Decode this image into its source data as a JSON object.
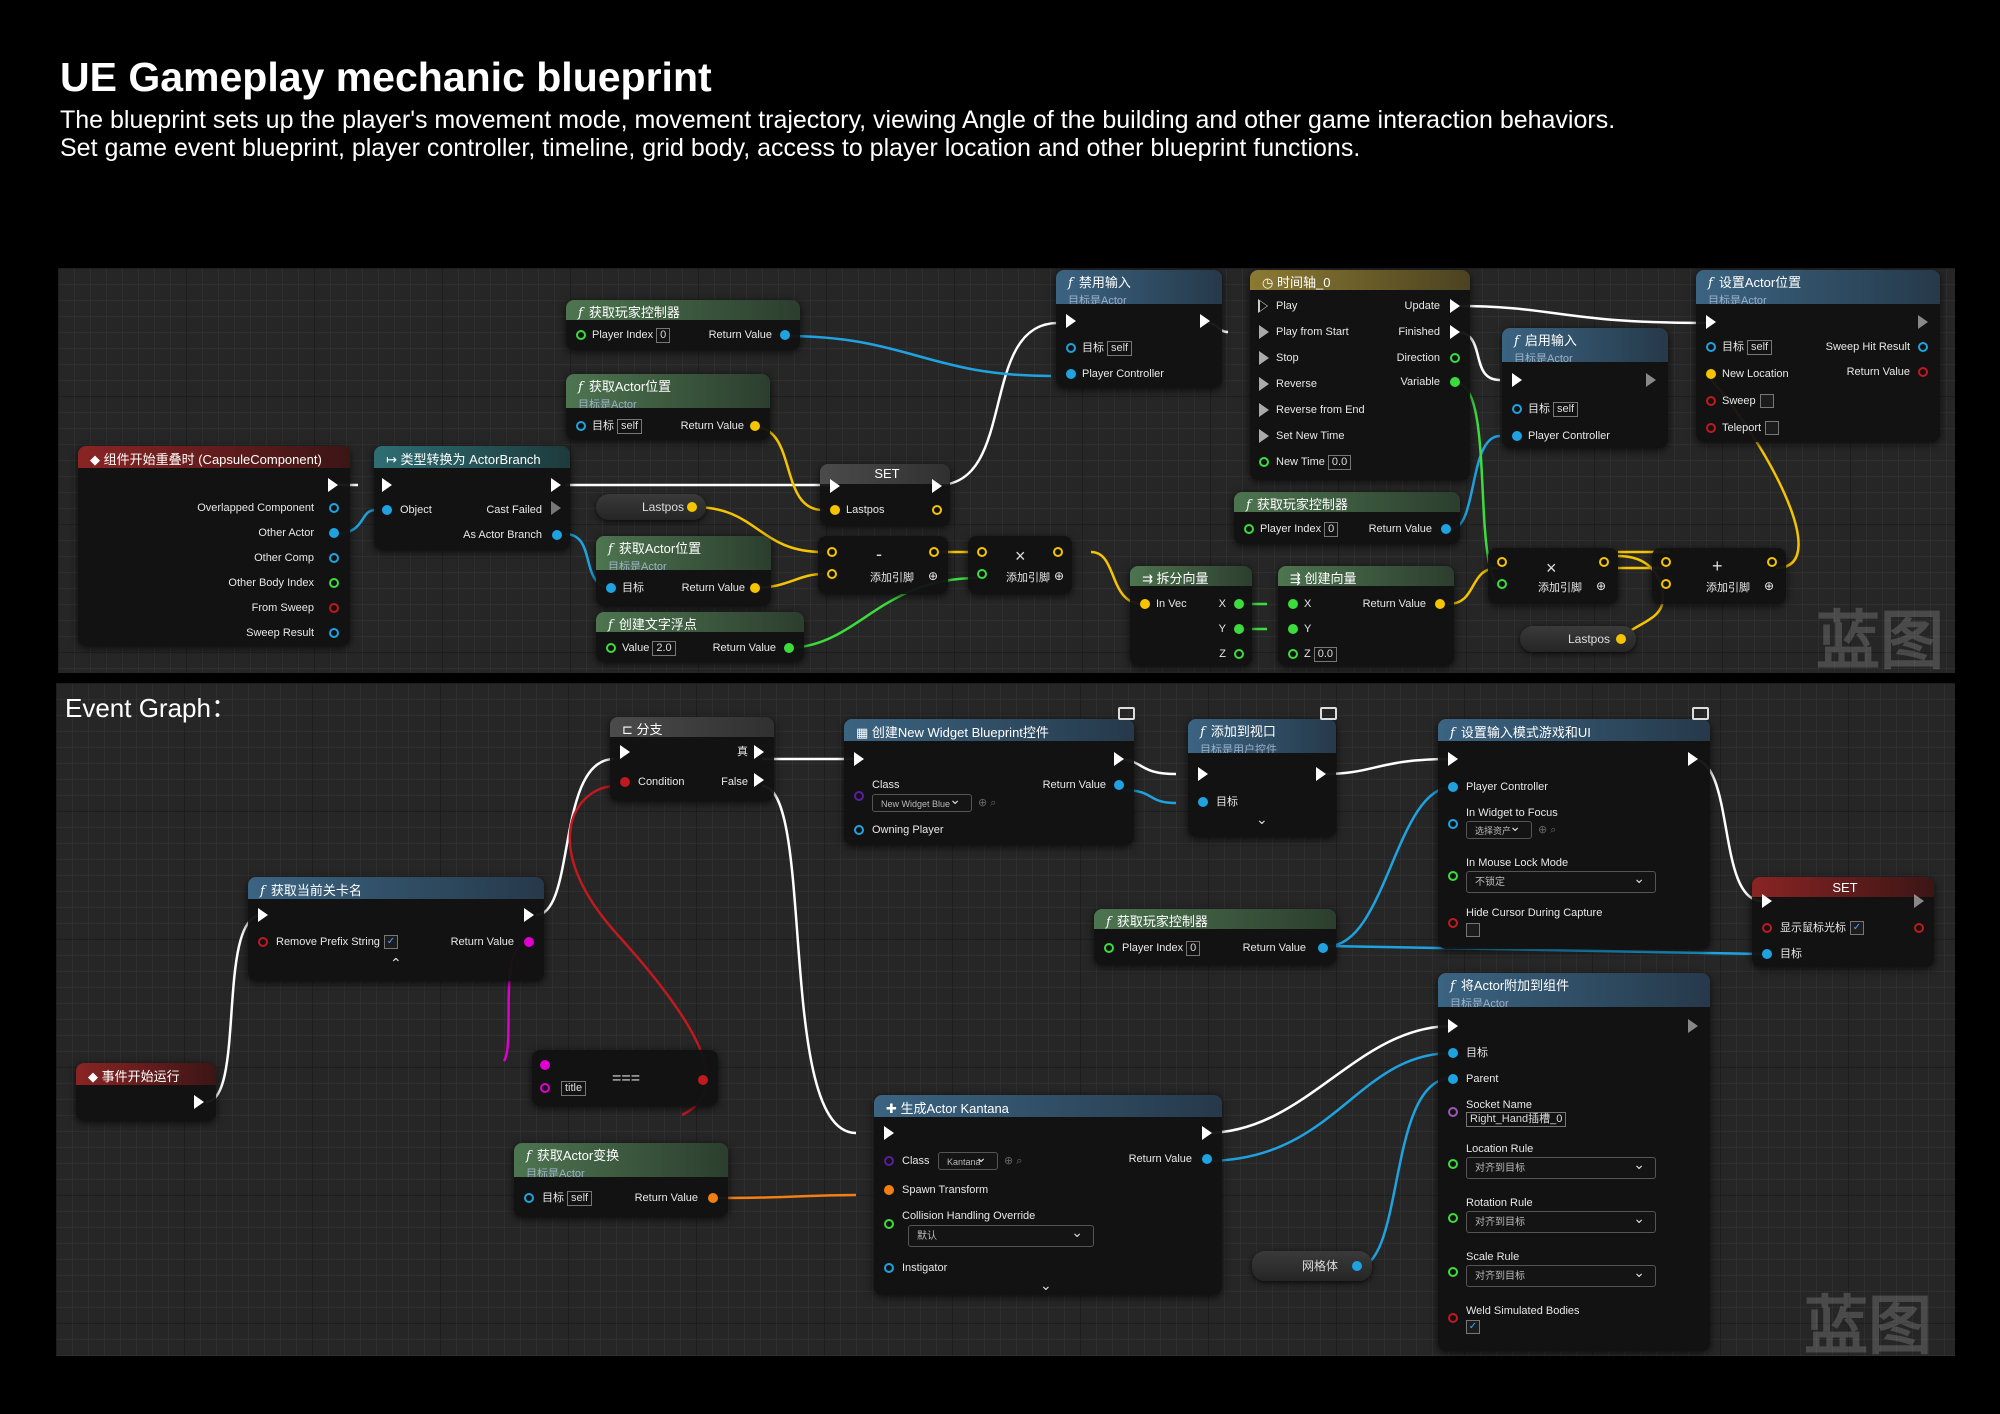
{
  "page": {
    "title": "UE Gameplay mechanic blueprint",
    "description": "The blueprint sets up the player's movement mode, movement trajectory, viewing Angle of the building and other game interaction behaviors. Set game event blueprint, player controller, timeline, grid body, access to player location and other blueprint functions."
  },
  "colors": {
    "exec": "#ffffff",
    "object": "#1fa3e0",
    "vector": "#f5c400",
    "float": "#3ddc3d",
    "bool": "#c0191f",
    "string": "#e000d0",
    "transform": "#f07f14",
    "class": "#5a1ea0"
  },
  "graph_top": {
    "watermark": "蓝图",
    "overlap_event": {
      "title": "组件开始重叠时 (CapsuleComponent)",
      "pins": [
        "Overlapped Component",
        "Other Actor",
        "Other Comp",
        "Other Body Index",
        "From Sweep",
        "Sweep Result"
      ]
    },
    "cast": {
      "title": "类型转换为 ActorBranch",
      "object": "Object",
      "cast_failed": "Cast Failed",
      "as_actor": "As Actor Branch"
    },
    "get_player_controller_1": {
      "title": "获取玩家控制器",
      "player_index": "Player Index",
      "index_value": "0",
      "return_value": "Return Value"
    },
    "get_actor_location_1": {
      "title": "获取Actor位置",
      "subtitle": "目标是Actor",
      "target": "目标",
      "self": "self",
      "return_value": "Return Value"
    },
    "lastpos_var_1": "Lastpos",
    "set_node": {
      "title": "SET",
      "pin": "Lastpos"
    },
    "get_actor_location_2": {
      "title": "获取Actor位置",
      "subtitle": "目标是Actor",
      "target": "目标",
      "return_value": "Return Value"
    },
    "make_float": {
      "title": "创建文字浮点",
      "value_label": "Value",
      "value": "2.0",
      "return_value": "Return Value"
    },
    "subtract_node": {
      "op": "-",
      "add_pin": "添加引脚"
    },
    "multiply_node_1": {
      "op": "×",
      "add_pin": "添加引脚"
    },
    "disable_input": {
      "title": "禁用输入",
      "subtitle": "目标是Actor",
      "target": "目标",
      "self": "self",
      "player_controller": "Player Controller"
    },
    "timeline": {
      "title": "时间轴_0",
      "inputs": [
        "Play",
        "Play from Start",
        "Stop",
        "Reverse",
        "Reverse from End",
        "Set New Time",
        "New Time"
      ],
      "new_time_value": "0.0",
      "outputs": [
        "Update",
        "Finished",
        "Direction",
        "Variable"
      ]
    },
    "get_player_controller_2": {
      "title": "获取玩家控制器",
      "player_index": "Player Index",
      "index_value": "0",
      "return_value": "Return Value"
    },
    "break_vector": {
      "title": "拆分向量",
      "in_vec": "In Vec",
      "x": "X",
      "y": "Y",
      "z": "Z"
    },
    "make_vector": {
      "title": "创建向量",
      "x": "X",
      "y": "Y",
      "z": "Z",
      "z_value": "0.0",
      "return_value": "Return Value"
    },
    "enable_input": {
      "title": "启用输入",
      "subtitle": "目标是Actor",
      "target": "目标",
      "self": "self",
      "player_controller": "Player Controller"
    },
    "multiply_node_2": {
      "op": "×",
      "add_pin": "添加引脚"
    },
    "add_node": {
      "op": "+",
      "add_pin": "添加引脚"
    },
    "lastpos_var_2": "Lastpos",
    "set_actor_location": {
      "title": "设置Actor位置",
      "subtitle": "目标是Actor",
      "target": "目标",
      "self": "self",
      "new_location": "New Location",
      "sweep": "Sweep",
      "teleport": "Teleport",
      "sweep_hit_result": "Sweep Hit Result",
      "return_value": "Return Value"
    }
  },
  "graph_bottom": {
    "label": "Event Graph：",
    "watermark": "蓝图",
    "begin_play": {
      "title": "事件开始运行"
    },
    "get_level_name": {
      "title": "获取当前关卡名",
      "remove_prefix": "Remove Prefix String",
      "return_value": "Return Value"
    },
    "branch": {
      "title": "分支",
      "condition": "Condition",
      "true_label": "真",
      "false_label": "False"
    },
    "equal_node": {
      "title_pin": "title",
      "op": "==="
    },
    "create_widget": {
      "title": "创建New Widget Blueprint控件",
      "class": "Class",
      "class_value": "New Widget Blue",
      "owning_player": "Owning Player",
      "return_value": "Return Value"
    },
    "add_to_viewport": {
      "title": "添加到视口",
      "subtitle": "目标是用户控件",
      "target": "目标"
    },
    "set_input_mode": {
      "title": "设置输入模式游戏和UI",
      "player_controller": "Player Controller",
      "widget_focus": "In Widget to Focus",
      "widget_value": "选择资产",
      "mouse_lock": "In Mouse Lock Mode",
      "mouse_lock_value": "不锁定",
      "hide_cursor": "Hide Cursor During Capture"
    },
    "get_player_controller": {
      "title": "获取玩家控制器",
      "player_index": "Player Index",
      "index_value": "0",
      "return_value": "Return Value"
    },
    "set_show_cursor": {
      "title": "SET",
      "show_cursor": "显示鼠标光标",
      "target": "目标"
    },
    "attach_actor": {
      "title": "将Actor附加到组件",
      "subtitle": "目标是Actor",
      "target": "目标",
      "parent": "Parent",
      "socket_name": "Socket Name",
      "socket_value": "Right_Hand插槽_0",
      "location_rule": "Location Rule",
      "location_value": "对齐到目标",
      "rotation_rule": "Rotation Rule",
      "rotation_value": "对齐到目标",
      "scale_rule": "Scale Rule",
      "scale_value": "对齐到目标",
      "weld": "Weld Simulated Bodies"
    },
    "spawn_actor": {
      "title": "生成Actor Kantana",
      "class": "Class",
      "class_value": "Kantana",
      "spawn_transform": "Spawn Transform",
      "collision": "Collision Handling Override",
      "collision_value": "默认",
      "instigator": "Instigator",
      "return_value": "Return Value"
    },
    "get_actor_transform": {
      "title": "获取Actor变换",
      "subtitle": "目标是Actor",
      "target": "目标",
      "self": "self",
      "return_value": "Return Value"
    },
    "mesh_var": "网格体"
  }
}
